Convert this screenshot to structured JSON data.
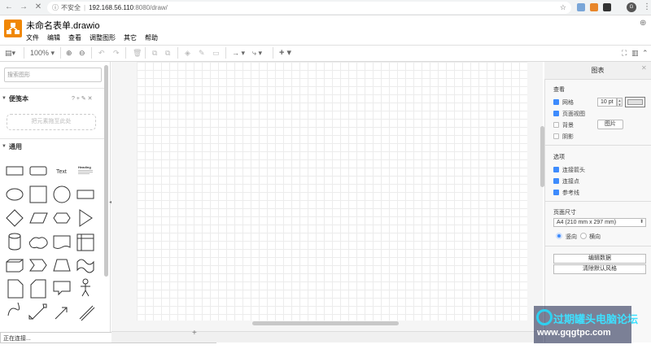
{
  "browser": {
    "back_icon": "←",
    "forward_icon": "→",
    "stop_icon": "✕",
    "insecure_label": "不安全",
    "host": "192.168.56.110",
    "path": ":8080/draw/",
    "star_icon": "☆",
    "avatar_letter": "G",
    "menu_icon": "⋮"
  },
  "app": {
    "title": "未命名表单.drawio",
    "menu": [
      "文件",
      "编辑",
      "查看",
      "调整图形",
      "其它",
      "帮助"
    ],
    "brand_color": "#f08705"
  },
  "toolbar": {
    "zoom": "100%",
    "zoom_in_icon": "⊕",
    "zoom_out_icon": "⊖",
    "undo_icon": "↶",
    "redo_icon": "↷",
    "delete_icon": "🗑",
    "add_icon": "+"
  },
  "left": {
    "search_placeholder": "搜索图形",
    "scratchpad": {
      "title": "便笺本",
      "tools": "? + ✎ ✕",
      "dropzone": "把元素拖至此处"
    },
    "general": {
      "title": "通用",
      "text_shape": "Text",
      "heading_shape": "Heading"
    },
    "status": "正在连接..."
  },
  "right": {
    "title": "图表",
    "close_icon": "✕",
    "view": {
      "heading": "查看",
      "grid": "网格",
      "grid_size": "10 pt",
      "page_view": "页面视图",
      "background": "背景",
      "image_button": "图片",
      "shadow": "阴影"
    },
    "options": {
      "heading": "选项",
      "connection_arrows": "连接箭头",
      "connection_points": "连接点",
      "guides": "参考线"
    },
    "page_size": {
      "heading": "页面尺寸",
      "value": "A4 (210 mm x 297 mm)",
      "portrait": "竖向",
      "landscape": "横向"
    },
    "edit_data": "编辑数据",
    "clear_style": "清除默认风格"
  },
  "watermark": {
    "title": "过期罐头电脑论坛",
    "url": "www.gqgtpc.com"
  }
}
